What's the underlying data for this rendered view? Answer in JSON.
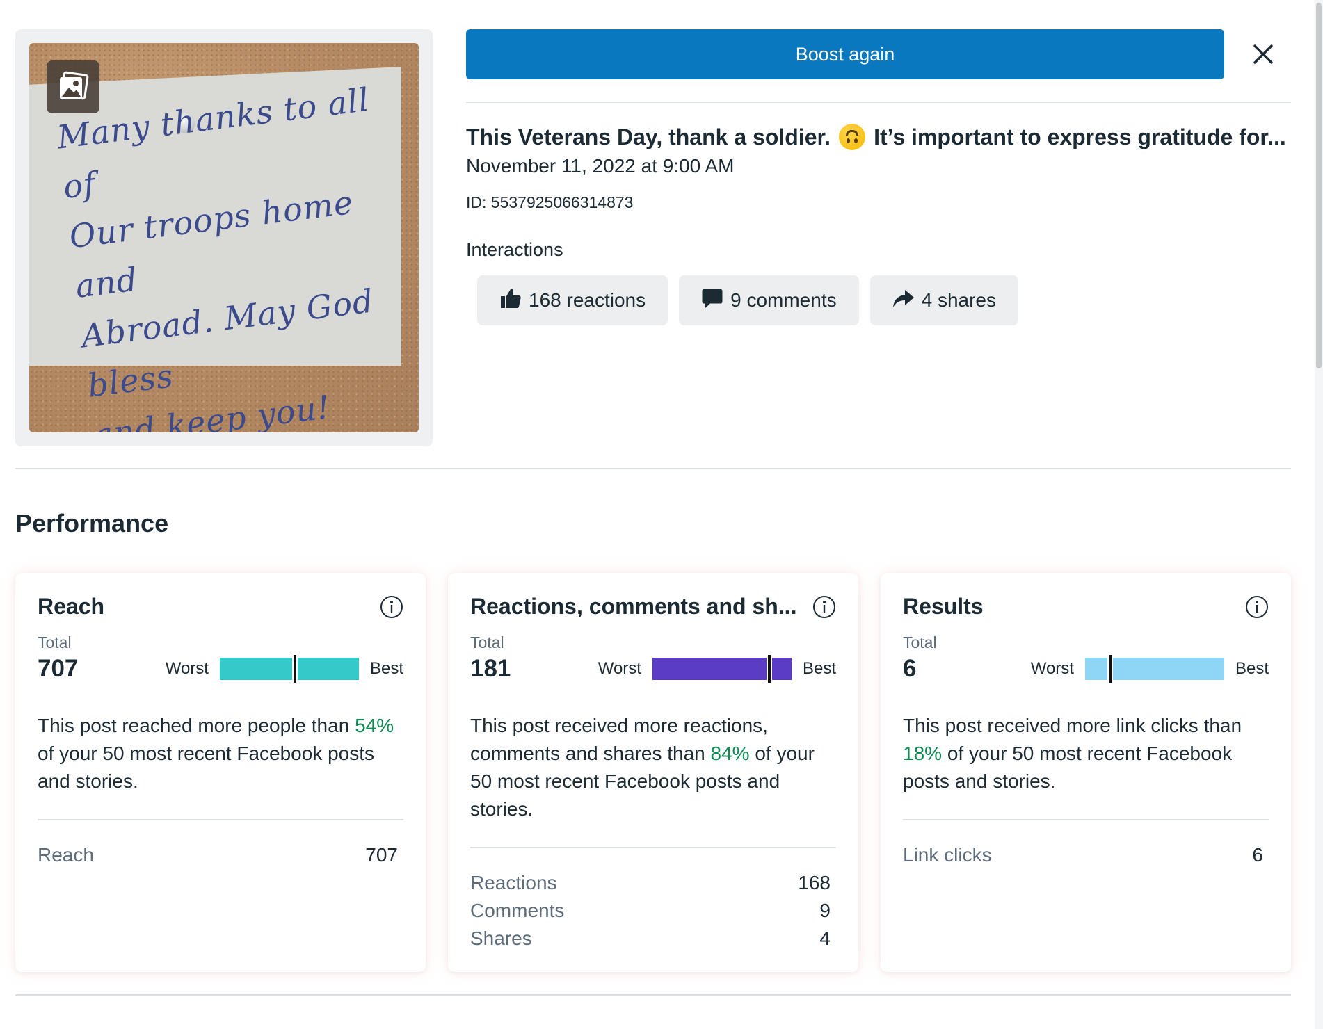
{
  "header": {
    "boost_label": "Boost again"
  },
  "post": {
    "title_part1": "This Veterans Day, thank a soldier.",
    "title_part2": "It’s important to express gratitude for...",
    "date": "November 11, 2022 at 9:00 AM",
    "id_text": "ID: 5537925066314873",
    "image_note_text": "Many thanks to all of\nOur troops home and\nAbroad. May God bless\nand keep you!\nLove, The Lipscombs"
  },
  "interactions": {
    "label": "Interactions",
    "reactions": "168 reactions",
    "comments": "9 comments",
    "shares": "4 shares"
  },
  "performance": {
    "title": "Performance",
    "total_label": "Total",
    "worst_label": "Worst",
    "best_label": "Best",
    "cards": [
      {
        "title": "Reach",
        "total": "707",
        "desc_before": "This post reached more people than ",
        "percent": "54%",
        "desc_after": " of your 50 most recent Facebook posts and stories.",
        "rank_fraction": 0.54,
        "bar_color": "#35c9c9",
        "rows": [
          {
            "label": "Reach",
            "value": "707"
          }
        ]
      },
      {
        "title": "Reactions, comments and sh...",
        "total": "181",
        "desc_before": "This post received more reactions, comments and shares than ",
        "percent": "84%",
        "desc_after": " of your 50 most recent Facebook posts and stories.",
        "rank_fraction": 0.84,
        "bar_color": "#5b3cc4",
        "rows": [
          {
            "label": "Reactions",
            "value": "168"
          },
          {
            "label": "Comments",
            "value": "9"
          },
          {
            "label": "Shares",
            "value": "4"
          }
        ]
      },
      {
        "title": "Results",
        "total": "6",
        "desc_before": "This post received more link clicks than ",
        "percent": "18%",
        "desc_after": " of your 50 most recent Facebook posts and stories.",
        "rank_fraction": 0.18,
        "bar_color": "#8fd5f5",
        "rows": [
          {
            "label": "Link clicks",
            "value": "6"
          }
        ]
      }
    ]
  },
  "colors": {
    "accent": "#0a78be",
    "positive": "#0f8a52"
  }
}
